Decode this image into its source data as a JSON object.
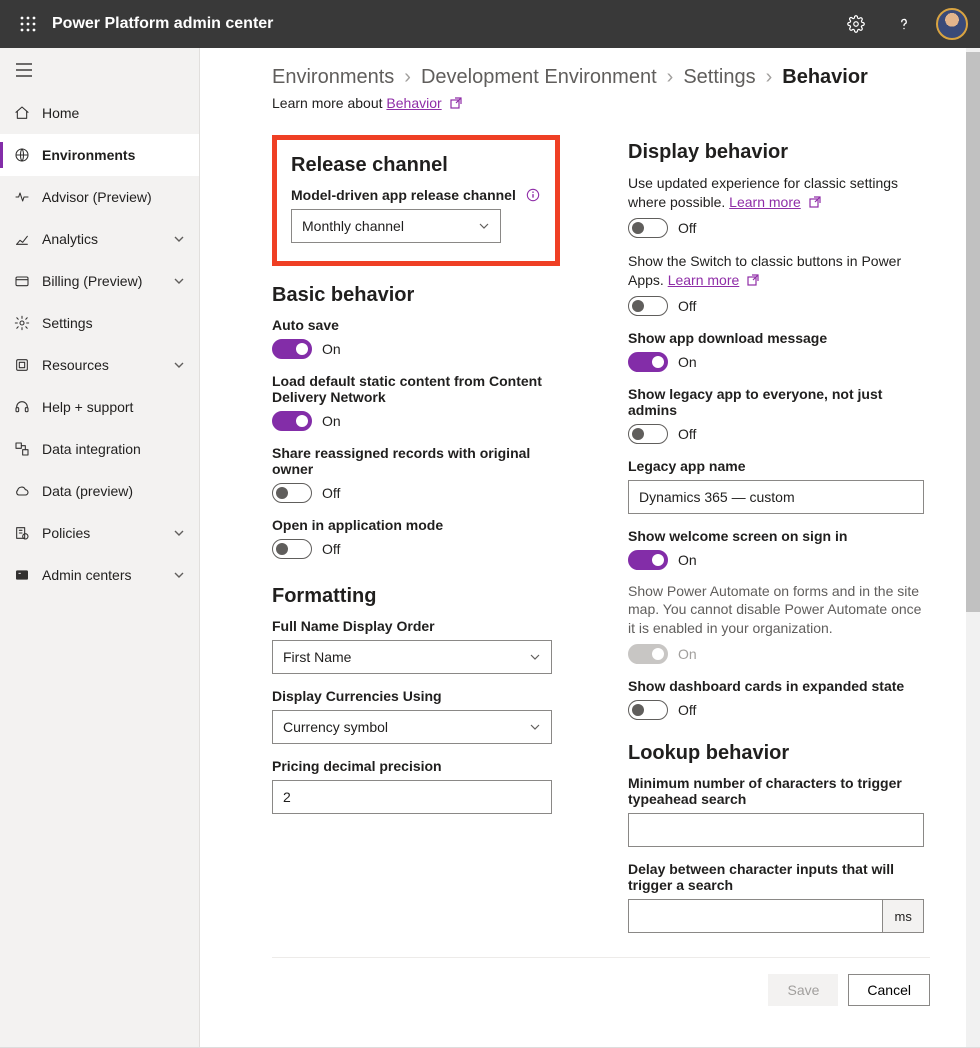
{
  "header": {
    "title": "Power Platform admin center"
  },
  "sidebar": {
    "items": [
      {
        "icon": "home",
        "label": "Home"
      },
      {
        "icon": "globe",
        "label": "Environments",
        "active": true
      },
      {
        "icon": "pulse",
        "label": "Advisor (Preview)"
      },
      {
        "icon": "analytics",
        "label": "Analytics",
        "exp": true
      },
      {
        "icon": "card",
        "label": "Billing (Preview)",
        "exp": true
      },
      {
        "icon": "gear",
        "label": "Settings"
      },
      {
        "icon": "box",
        "label": "Resources",
        "exp": true
      },
      {
        "icon": "headset",
        "label": "Help + support"
      },
      {
        "icon": "dataint",
        "label": "Data integration"
      },
      {
        "icon": "cloud",
        "label": "Data (preview)"
      },
      {
        "icon": "policy",
        "label": "Policies",
        "exp": true
      },
      {
        "icon": "admin",
        "label": "Admin centers",
        "exp": true
      }
    ]
  },
  "breadcrumb": {
    "seg1": "Environments",
    "seg2": "Development Environment",
    "seg3": "Settings",
    "seg4": "Behavior"
  },
  "learnmore": {
    "prefix": "Learn more about ",
    "link": "Behavior"
  },
  "left": {
    "release": {
      "heading": "Release channel",
      "label": "Model-driven app release channel",
      "value": "Monthly channel"
    },
    "basic": {
      "heading": "Basic behavior",
      "autosave": {
        "label": "Auto save",
        "state": "On"
      },
      "cdn": {
        "label": "Load default static content from Content Delivery Network",
        "state": "On"
      },
      "share": {
        "label": "Share reassigned records with original owner",
        "state": "Off"
      },
      "openapp": {
        "label": "Open in application mode",
        "state": "Off"
      }
    },
    "formatting": {
      "heading": "Formatting",
      "fullname": {
        "label": "Full Name Display Order",
        "value": "First Name"
      },
      "currency": {
        "label": "Display Currencies Using",
        "value": "Currency symbol"
      },
      "precision": {
        "label": "Pricing decimal precision",
        "value": "2"
      }
    }
  },
  "right": {
    "display": {
      "heading": "Display behavior",
      "updated": {
        "text": "Use updated experience for classic settings where possible. ",
        "link": "Learn more",
        "state": "Off"
      },
      "switch": {
        "text": "Show the Switch to classic buttons in Power Apps. ",
        "link": "Learn more",
        "state": "Off"
      },
      "download": {
        "label": "Show app download message",
        "state": "On"
      },
      "legacyall": {
        "label": "Show legacy app to everyone, not just admins",
        "state": "Off"
      },
      "legacyname": {
        "label": "Legacy app name",
        "value": "Dynamics 365 — custom"
      },
      "welcome": {
        "label": "Show welcome screen on sign in",
        "state": "On"
      },
      "flow": {
        "text": "Show Power Automate on forms and in the site map. You cannot disable Power Automate once it is enabled in your organization.",
        "state": "On"
      },
      "dashboard": {
        "label": "Show dashboard cards in expanded state",
        "state": "Off"
      }
    },
    "lookup": {
      "heading": "Lookup behavior",
      "min": {
        "label": "Minimum number of characters to trigger typeahead search",
        "value": ""
      },
      "delay": {
        "label": "Delay between character inputs that will trigger a search",
        "value": "",
        "unit": "ms"
      }
    }
  },
  "footer": {
    "save": "Save",
    "cancel": "Cancel"
  }
}
